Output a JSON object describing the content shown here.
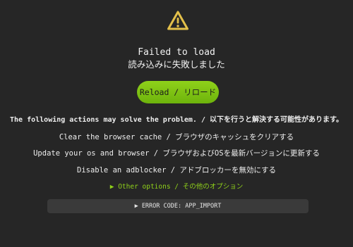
{
  "error": {
    "title_en": "Failed to load",
    "title_ja": "読み込みに失敗しました",
    "icon": "warning-triangle-icon"
  },
  "reload_button": {
    "label": "Reload / リロード"
  },
  "suggestions": {
    "heading": "The following actions may solve the problem. / 以下を行うと解決する可能性があります。",
    "items": [
      "Clear the browser cache / ブラウザのキャッシュをクリアする",
      "Update your os and browser / ブラウザおよびOSを最新バージョンに更新する",
      "Disable an adblocker / アドブロッカーを無効にする"
    ]
  },
  "other_options": {
    "label": "▶ Other options / その他のオプション"
  },
  "error_code": {
    "label": "▶ ERROR CODE: APP_IMPORT"
  },
  "colors": {
    "background": "#262626",
    "accent": "#8fd11a",
    "warning": "#e3c04a",
    "panel": "#3a3a3a"
  }
}
